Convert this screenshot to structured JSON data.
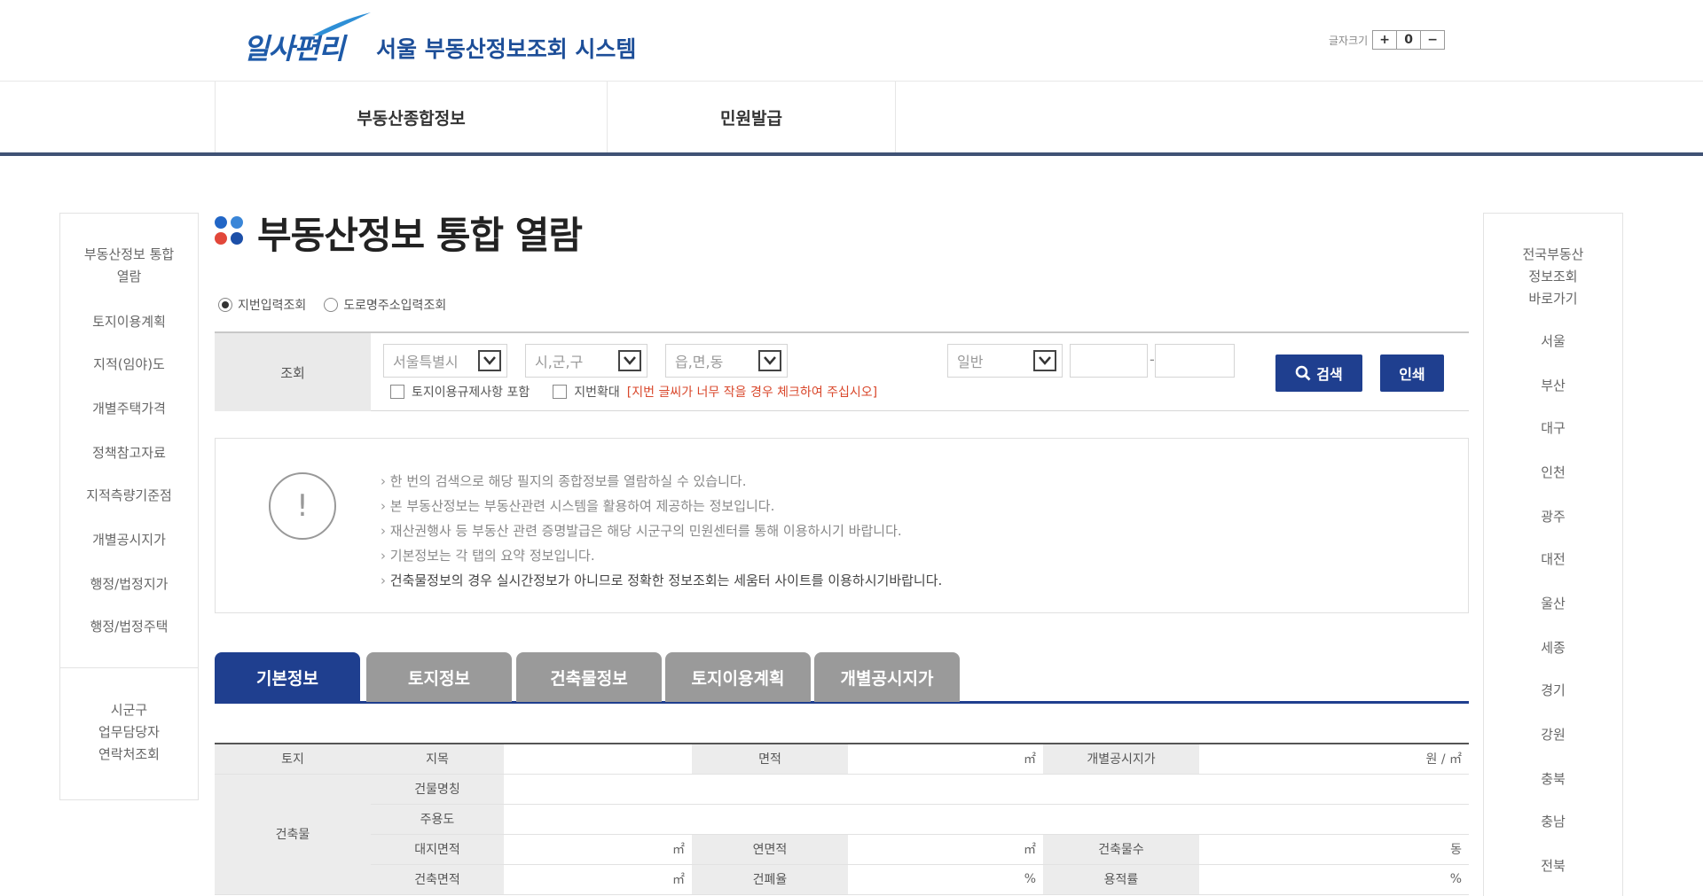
{
  "header": {
    "logo_brand": "일사편리",
    "logo_sub": "서울 부동산정보조회 시스템",
    "font_size_label": "글자크기",
    "font_buttons": [
      "+",
      "0",
      "−"
    ]
  },
  "gnb": [
    "부동산종합정보",
    "민원발급"
  ],
  "left_menu": {
    "items": [
      "부동산정보 통합\n열람",
      "토지이용계획",
      "지적(임야)도",
      "개별주택가격",
      "정책참고자료",
      "지적측량기준점",
      "개별공시지가",
      "행정/법정지가",
      "행정/법정주택"
    ],
    "bottom": "시군구\n업무담당자\n연락처조회"
  },
  "right_menu": {
    "title": "전국부동산\n정보조회\n바로가기",
    "items": [
      "서울",
      "부산",
      "대구",
      "인천",
      "광주",
      "대전",
      "울산",
      "세종",
      "경기",
      "강원",
      "충북",
      "충남",
      "전북"
    ]
  },
  "page_title": "부동산정보 통합 열람",
  "search": {
    "radio_options": [
      "지번입력조회",
      "도로명주소입력조회"
    ],
    "label": "조회",
    "sido_value": "서울특별시",
    "sigungu_value": "시,군,구",
    "dong_value": "읍,면,동",
    "jibun_type_value": "일반",
    "checkbox_1": "토지이용규제사항 포함",
    "checkbox_2": "지번확대",
    "warning": "[지번 글씨가 너무 작을 경우 체크하여 주십시오]",
    "search_button": "검색",
    "print_button": "인쇄"
  },
  "notice": [
    "한 번의 검색으로 해당 필지의 종합정보를 열람하실 수 있습니다.",
    "본 부동산정보는 부동산관련 시스템을 활용하여 제공하는 정보입니다.",
    "재산권행사 등 부동산 관련 증명발급은 해당 시군구의 민원센터를 통해 이용하시기 바랍니다.",
    "기본정보는 각 탭의 요약 정보입니다.",
    "건축물정보의 경우 실시간정보가 아니므로 정확한 정보조회는 세움터 사이트를 이용하시기바랍니다."
  ],
  "tabs": [
    "기본정보",
    "토지정보",
    "건축물정보",
    "토지이용계획",
    "개별공시지가"
  ],
  "basic_info": {
    "land": "토지",
    "building": "건축물",
    "jimok": "지목",
    "area": "면적",
    "area_unit": "㎡",
    "land_price": "개별공시지가",
    "land_price_unit": "원 / ㎡",
    "building_name": "건물명칭",
    "structure": "주용도",
    "site_area": "대지면적",
    "site_area_unit": "㎡",
    "total_floor_area": "연면적",
    "total_floor_area_unit": "㎡",
    "building_count": "건축물수",
    "building_count_unit": "동",
    "building_area": "건축면적",
    "building_area_unit": "㎡",
    "coverage": "건폐율",
    "coverage_unit": "%",
    "floor_ratio": "용적률",
    "floor_ratio_unit": "%"
  },
  "colors": {
    "brand_blue": "#1f3f8f",
    "gnb_border": "#3f5275",
    "warning_red": "#d9472b",
    "dot_blue_1": "#2266c6",
    "dot_blue_2": "#3a86d8",
    "dot_red": "#e2473a",
    "dot_blue_3": "#1c4fa8"
  },
  "icons": [
    "logo-swoosh-icon",
    "title-dots-icon",
    "select-arrow-icon",
    "search-icon",
    "notice-exclamation-icon"
  ]
}
